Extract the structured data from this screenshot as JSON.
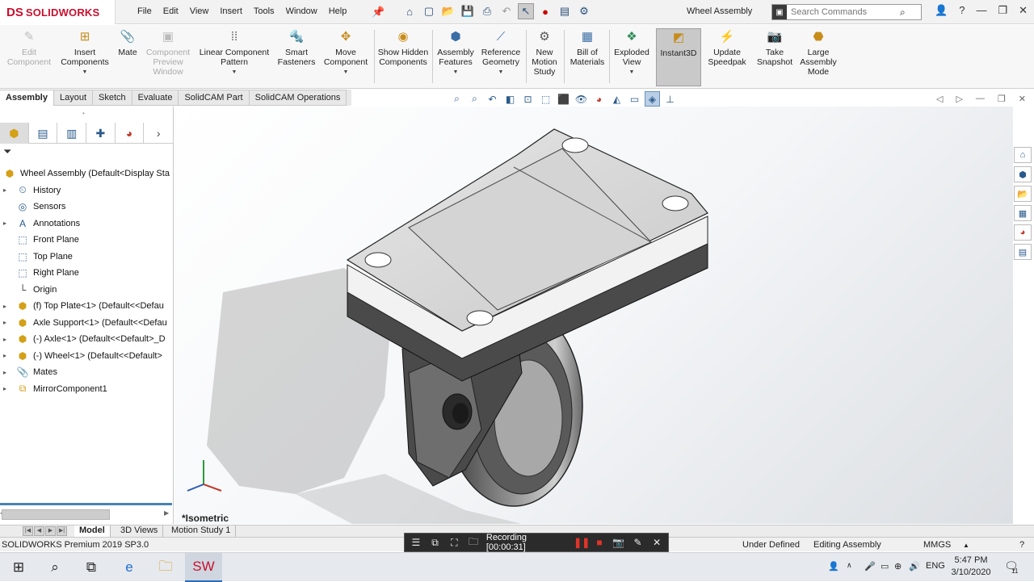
{
  "app": {
    "logo_ds": "DS",
    "logo_text": "SOLIDWORKS",
    "document_title": "Wheel Assembly"
  },
  "menu": [
    "File",
    "Edit",
    "View",
    "Insert",
    "Tools",
    "Window",
    "Help"
  ],
  "search": {
    "placeholder": "Search Commands"
  },
  "ribbon": {
    "edit_component": "Edit Component",
    "insert_components": "Insert Components",
    "mate": "Mate",
    "component_preview": "Component Preview Window",
    "linear_pattern": "Linear Component Pattern",
    "smart_fasteners": "Smart Fasteners",
    "move_component": "Move Component",
    "show_hidden": "Show Hidden Components",
    "assembly_features": "Assembly Features",
    "reference_geometry": "Reference Geometry",
    "new_motion_study": "New Motion Study",
    "bill_of_materials": "Bill of Materials",
    "exploded_view": "Exploded View",
    "instant3d": "Instant3D",
    "update_speedpak": "Update Speedpak",
    "take_snapshot": "Take Snapshot",
    "large_assembly_mode": "Large Assembly Mode"
  },
  "command_tabs": [
    "Assembly",
    "Layout",
    "Sketch",
    "Evaluate",
    "SolidCAM Part",
    "SolidCAM Operations"
  ],
  "tree": {
    "root": "Wheel Assembly  (Default<Display Sta",
    "items": [
      {
        "label": "History",
        "icon": "history-icon",
        "expandable": true
      },
      {
        "label": "Sensors",
        "icon": "sensor-icon",
        "expandable": false
      },
      {
        "label": "Annotations",
        "icon": "annotation-icon",
        "expandable": true
      },
      {
        "label": "Front Plane",
        "icon": "plane-icon",
        "expandable": false
      },
      {
        "label": "Top Plane",
        "icon": "plane-icon",
        "expandable": false
      },
      {
        "label": "Right Plane",
        "icon": "plane-icon",
        "expandable": false
      },
      {
        "label": "Origin",
        "icon": "origin-icon",
        "expandable": false
      },
      {
        "label": "(f) Top Plate<1> (Default<<Defau",
        "icon": "part-icon",
        "expandable": true
      },
      {
        "label": "Axle Support<1> (Default<<Defau",
        "icon": "part-icon",
        "expandable": true
      },
      {
        "label": "(-) Axle<1> (Default<<Default>_D",
        "icon": "part-icon",
        "expandable": true
      },
      {
        "label": "(-) Wheel<1> (Default<<Default>",
        "icon": "part-icon",
        "expandable": true
      },
      {
        "label": "Mates",
        "icon": "mates-icon",
        "expandable": true
      },
      {
        "label": "MirrorComponent1",
        "icon": "mirror-component-icon",
        "expandable": true
      }
    ]
  },
  "viewport": {
    "view_label": "*Isometric"
  },
  "bottom_tabs": [
    "Model",
    "3D Views",
    "Motion Study 1"
  ],
  "status": {
    "version": "SOLIDWORKS Premium 2019 SP3.0",
    "defined": "Under Defined",
    "mode": "Editing Assembly",
    "units": "MMGS"
  },
  "recording": {
    "label": "Recording [00:00:31]"
  },
  "taskbar": {
    "language": "ENG",
    "time": "5:47 PM",
    "date": "3/10/2020",
    "notifications": "11"
  }
}
